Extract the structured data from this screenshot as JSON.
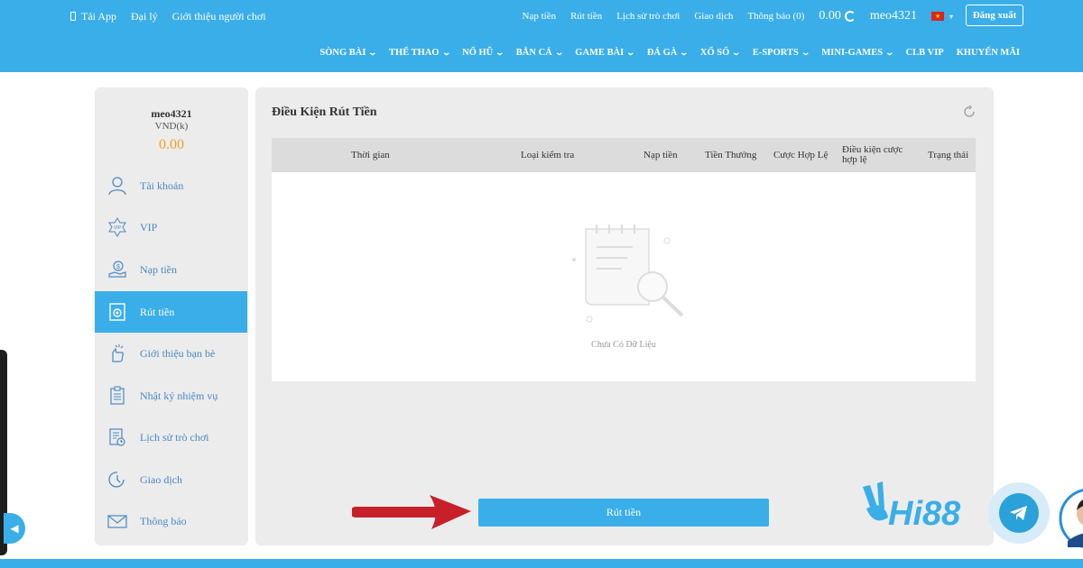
{
  "topbar": {
    "left_links": [
      "Tải App",
      "Đại lý",
      "Giới thiệu người chơi"
    ],
    "right_links": [
      "Nạp tiền",
      "Rút tiền",
      "Lịch sử trò chơi",
      "Giao dịch",
      "Thông báo (0)"
    ],
    "balance": "0.00",
    "username": "meo4321",
    "logout_label": "Đăng xuất",
    "accent_color": "#3aaee8"
  },
  "nav": {
    "items": [
      "SÒNG BÀI",
      "THỂ THAO",
      "NỔ HŨ",
      "BẮN CÁ",
      "GAME BÀI",
      "ĐÁ GÀ",
      "XỔ SỐ",
      "E-SPORTS",
      "MINI-GAMES",
      "CLB VIP",
      "KHUYẾN MÃI"
    ]
  },
  "sidebar": {
    "username": "meo4321",
    "currency": "VND(k)",
    "balance": "0.00",
    "items": [
      {
        "label": "Tài khoản",
        "icon": "user-icon"
      },
      {
        "label": "VIP",
        "icon": "vip-badge-icon"
      },
      {
        "label": "Nạp tiền",
        "icon": "deposit-icon"
      },
      {
        "label": "Rút tiền",
        "icon": "withdraw-icon",
        "active": true
      },
      {
        "label": "Giới thiệu bạn bè",
        "icon": "referral-icon"
      },
      {
        "label": "Nhật ký nhiệm vụ",
        "icon": "task-log-icon"
      },
      {
        "label": "Lịch sử trò chơi",
        "icon": "game-history-icon"
      },
      {
        "label": "Giao dịch",
        "icon": "transaction-icon"
      },
      {
        "label": "Thông báo",
        "icon": "mail-icon"
      }
    ]
  },
  "main": {
    "title": "Điều Kiện Rút Tiền",
    "columns": [
      "Thời gian",
      "Loại kiểm tra",
      "Nạp tiền",
      "Tiền Thưởng",
      "Cược Hợp Lệ",
      "Điều kiện cược hợp lệ",
      "Trạng thái"
    ],
    "empty_text": "Chưa Có Dữ Liệu",
    "withdraw_button": "Rút tiền"
  },
  "brand": {
    "logo_text": "Hi88"
  }
}
